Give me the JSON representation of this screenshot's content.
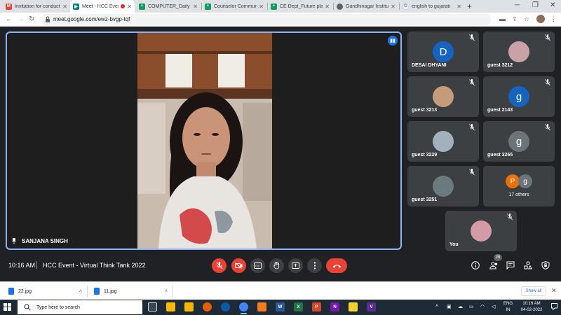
{
  "browser": {
    "tabs": [
      {
        "label": "Invitation for conduct",
        "icon": "gmail-icon",
        "color": "#ea4335"
      },
      {
        "label": "Meet - HCC Even",
        "icon": "meet-icon",
        "color": "#00897b"
      },
      {
        "label": "COMPUTER_Daily Att",
        "icon": "sheets-icon",
        "color": "#0f9d58"
      },
      {
        "label": "Counselor Communi",
        "icon": "sheets-icon",
        "color": "#0f9d58"
      },
      {
        "label": "CE Dept_Future plan",
        "icon": "sheets-icon",
        "color": "#0f9d58"
      },
      {
        "label": "Gandhinagar Institute",
        "icon": "globe-icon",
        "color": "#5f6368"
      },
      {
        "label": "english to gujarati",
        "icon": "google-icon",
        "color": "#4285f4"
      }
    ],
    "active_tab": 1,
    "url": "meet.google.com/ewz-bvgp-tqf"
  },
  "meeting": {
    "time": "10:16 AM",
    "title": "HCC Event - Virtual Think Tank 2022",
    "participants_count": "26",
    "main_speaker": "SANJANA SINGH",
    "accent_color": "#8ab4f8",
    "end_color": "#ea4335"
  },
  "participants": [
    {
      "name": "DESAI DHYANI",
      "avatar": "D",
      "type": "letter",
      "color": "#1565c0"
    },
    {
      "name": "guest 3212",
      "avatar": "",
      "type": "photo",
      "color": "#c9a2a8"
    },
    {
      "name": "guest 3213",
      "avatar": "",
      "type": "photo",
      "color": "#c59b7a"
    },
    {
      "name": "guest 2143",
      "avatar": "g",
      "type": "letter",
      "color": "#1565c0"
    },
    {
      "name": "guest 3229",
      "avatar": "",
      "type": "photo",
      "color": "#a3b1bf"
    },
    {
      "name": "guest 3265",
      "avatar": "g",
      "type": "letter",
      "color": "#6b7579"
    },
    {
      "name": "guest 3251",
      "avatar": "",
      "type": "photo",
      "color": "#6b7a7f"
    },
    {
      "name": "17 others",
      "avatar": "",
      "type": "others",
      "color": ""
    },
    {
      "name": "You",
      "avatar": "",
      "type": "photo",
      "color": "#d39aa8"
    }
  ],
  "others_avatars": [
    {
      "letter": "P",
      "color": "#e8710a"
    },
    {
      "letter": "g",
      "color": "#6b7579"
    }
  ],
  "downloads": [
    {
      "name": "22.jpg"
    },
    {
      "name": "11.jpg"
    }
  ],
  "downloads_show_all": "Show all",
  "taskbar": {
    "search_placeholder": "Type here to search",
    "time": "10:16 AM",
    "date": "04-02-2022",
    "lang": "ENG",
    "region": "IN",
    "apps": [
      {
        "name": "task-view",
        "color": "#3a4756",
        "glyph": ""
      },
      {
        "name": "calculator",
        "color": "#ffb900",
        "glyph": ""
      },
      {
        "name": "file-explorer",
        "color": "#f4b400",
        "glyph": ""
      },
      {
        "name": "firefox",
        "color": "#e66000",
        "glyph": ""
      },
      {
        "name": "edge",
        "color": "#0c59a4",
        "glyph": ""
      },
      {
        "name": "chrome",
        "color": "#4285f4",
        "glyph": ""
      },
      {
        "name": "orange-app",
        "color": "#f47b20",
        "glyph": ""
      },
      {
        "name": "word",
        "color": "#2b579a",
        "glyph": "W"
      },
      {
        "name": "excel",
        "color": "#217346",
        "glyph": "X"
      },
      {
        "name": "powerpoint",
        "color": "#d24726",
        "glyph": "P"
      },
      {
        "name": "onenote",
        "color": "#7719aa",
        "glyph": "N"
      },
      {
        "name": "sticky-notes",
        "color": "#f7d12e",
        "glyph": ""
      },
      {
        "name": "visual-studio",
        "color": "#5c2d91",
        "glyph": "V"
      }
    ]
  }
}
